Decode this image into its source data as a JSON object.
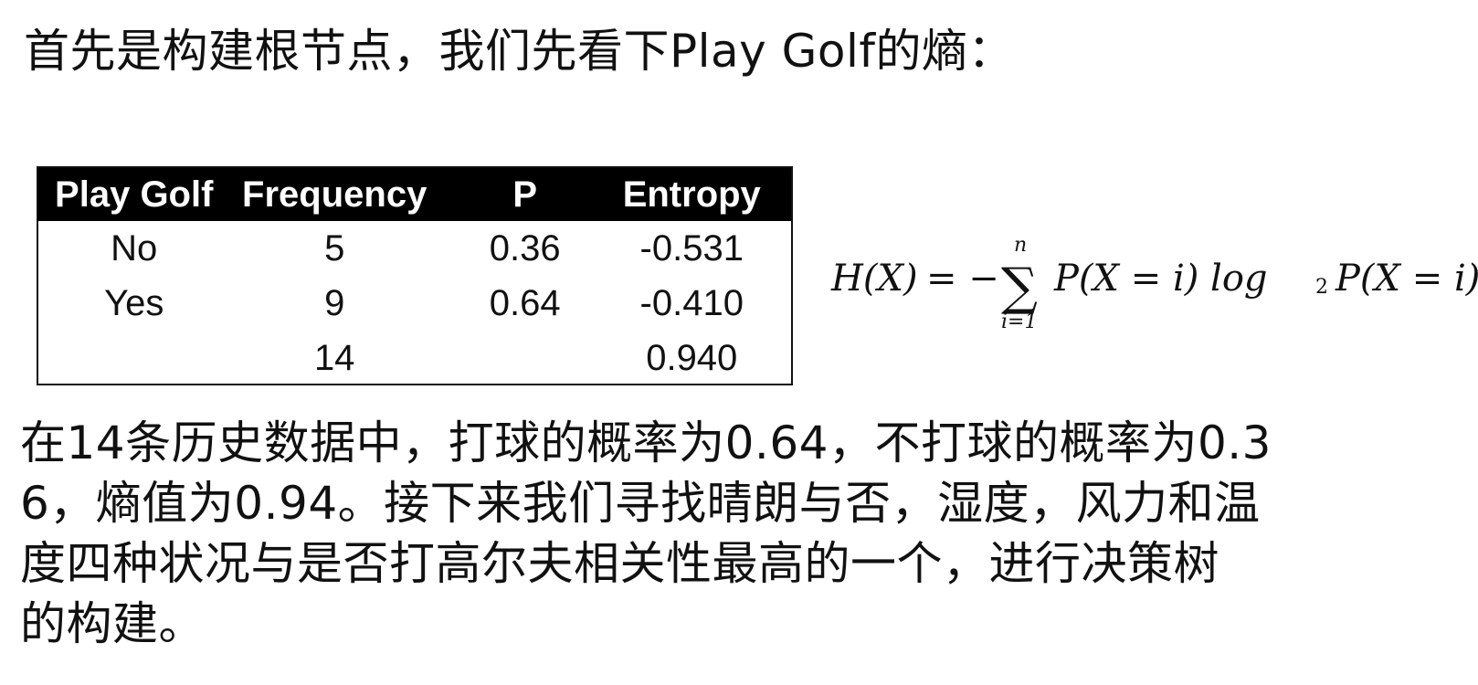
{
  "intro": "首先是构建根节点，我们先看下Play Golf的熵：",
  "table": {
    "headers": [
      "Play Golf",
      "Frequency",
      "P",
      "Entropy"
    ],
    "rows": [
      [
        "No",
        "5",
        "0.36",
        "-0.531"
      ],
      [
        "Yes",
        "9",
        "0.64",
        "-0.410"
      ],
      [
        "",
        "14",
        "",
        "0.940"
      ]
    ]
  },
  "formula": {
    "lhs": "H(X)",
    "eq": "= −",
    "sigma": "∑",
    "upper": "n",
    "lower": "i=1",
    "term": "P(X = i) log",
    "base": "2",
    "tail": "P(X = i)"
  },
  "paragraph": {
    "lines": [
      "在14条历史数据中，打球的概率为0.64，不打球的概率为0.3",
      "6，熵值为0.94。接下来我们寻找晴朗与否，湿度，风力和温",
      "度四种状况与是否打高尔夫相关性最高的一个，进行决策树",
      "的构建。"
    ]
  }
}
